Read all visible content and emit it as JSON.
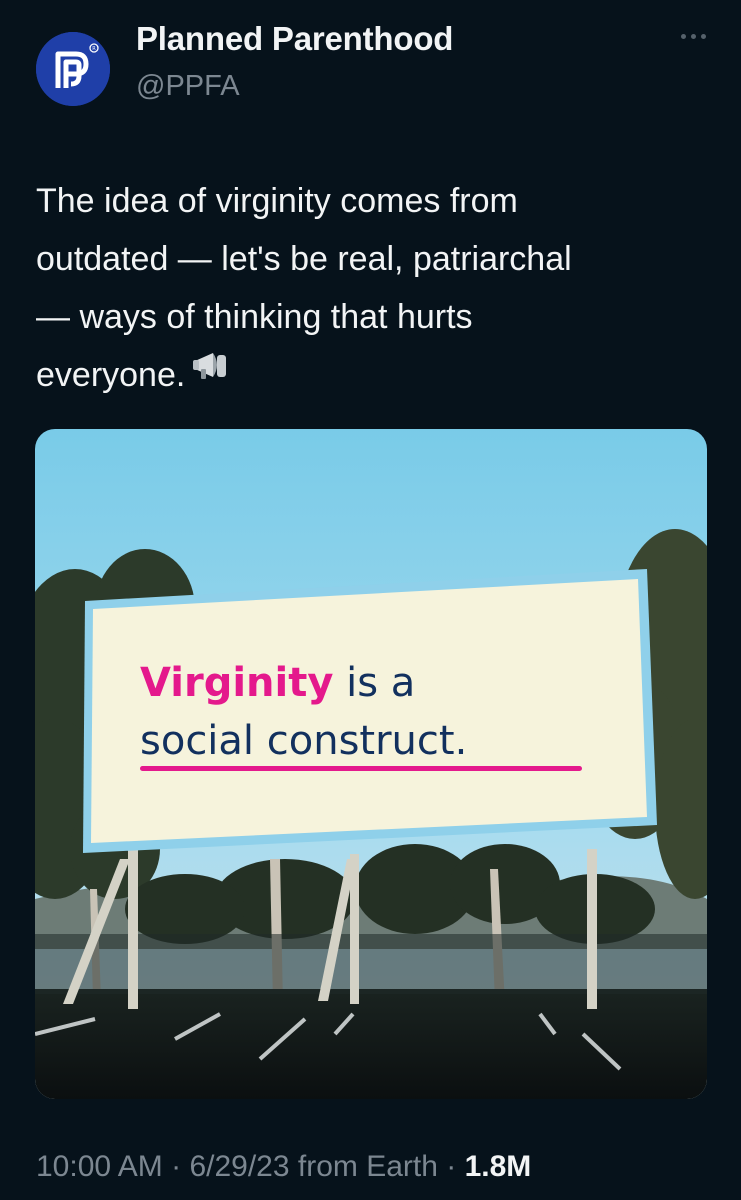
{
  "author": {
    "name": "Planned Parenthood",
    "handle": "@PPFA",
    "avatar_icon": "planned-parenthood-logo-icon",
    "brand_color": "#1f3fa8"
  },
  "more_icon": "more-horizontal-icon",
  "tweet": {
    "lines": [
      "The idea of virginity comes from",
      "outdated — let's be real, patriarchal",
      "— ways of thinking that hurts",
      "everyone."
    ],
    "emoji_icon": "megaphone-icon"
  },
  "media": {
    "billboard": {
      "word_highlight": "Virginity",
      "line1_rest": " is a",
      "line2": "social construct.",
      "highlight_color": "#e4198c",
      "text_color": "#12305e"
    }
  },
  "meta": {
    "time": "10:00 AM",
    "sep1": " · ",
    "date": "6/29/23",
    "source": " from Earth",
    "sep2": " · ",
    "views": "1.8M"
  }
}
